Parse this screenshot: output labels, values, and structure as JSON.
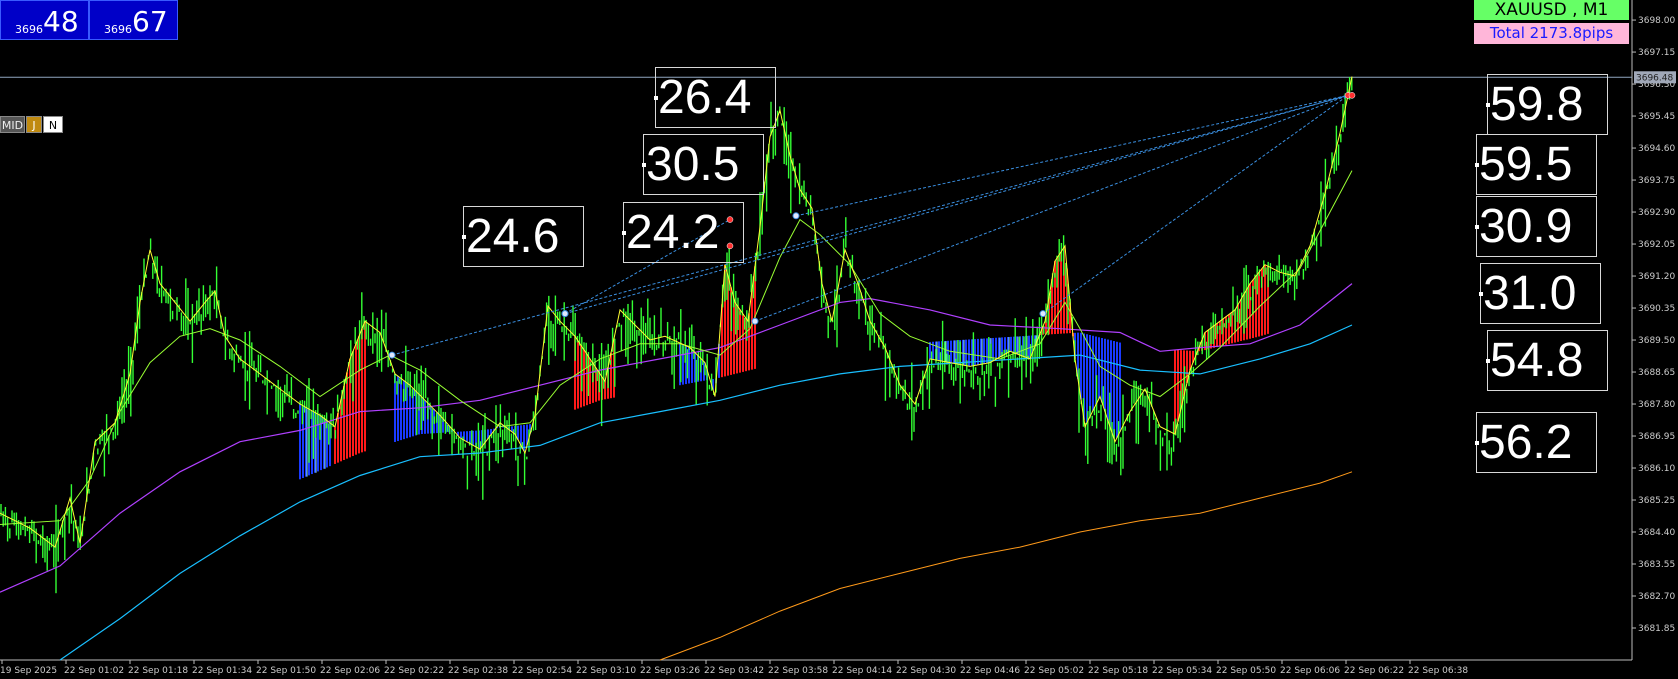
{
  "bid_boxes": [
    {
      "small": "3696",
      "big": "48"
    },
    {
      "small": "3696",
      "big": "67"
    }
  ],
  "mode_buttons": [
    "MID",
    "J",
    "N"
  ],
  "symbol_label": "XAUUSD , M1",
  "total_label": "Total  2173.8pips",
  "current_price_label": "3696.48",
  "labels": [
    "26.4",
    "30.5",
    "24.6",
    "24.2",
    "59.8",
    "59.5",
    "30.9",
    "31.0",
    "54.8",
    "56.2"
  ],
  "chart_data": {
    "type": "line",
    "title": "XAUUSD , M1",
    "ylim": [
      3681.0,
      3698.4
    ],
    "y_ticks": [
      "3698.00",
      "3697.15",
      "3696.30",
      "3695.45",
      "3694.60",
      "3693.75",
      "3692.90",
      "3692.05",
      "3691.20",
      "3690.35",
      "3689.50",
      "3688.65",
      "3687.80",
      "3686.95",
      "3686.10",
      "3685.25",
      "3684.40",
      "3683.55",
      "3682.70",
      "3681.85"
    ],
    "x_ticks": [
      "19 Sep 2025",
      "22 Sep 01:02",
      "22 Sep 01:18",
      "22 Sep 01:34",
      "22 Sep 01:50",
      "22 Sep 02:06",
      "22 Sep 02:22",
      "22 Sep 02:38",
      "22 Sep 02:54",
      "22 Sep 03:10",
      "22 Sep 03:26",
      "22 Sep 03:42",
      "22 Sep 03:58",
      "22 Sep 04:14",
      "22 Sep 04:30",
      "22 Sep 04:46",
      "22 Sep 05:02",
      "22 Sep 05:18",
      "22 Sep 05:34",
      "22 Sep 05:50",
      "22 Sep 06:06",
      "22 Sep 06:22",
      "22 Sep 06:38"
    ],
    "current_price": 3696.48,
    "colors": {
      "price": "#33ff33",
      "fast_ma": "#ffff33",
      "mid_ma": "#99ff33",
      "purple_ma": "#b040ff",
      "cyan_ma": "#19bfff",
      "orange_ma": "#ff9a1a",
      "bull_fill": "#ff1a1a",
      "bear_fill": "#1a3aff"
    },
    "series": [
      {
        "points": [
          [
            0,
            3684.9
          ],
          [
            30,
            3684.5
          ],
          [
            55,
            3684.0
          ],
          [
            70,
            3685.3
          ],
          [
            80,
            3684.1
          ],
          [
            95,
            3686.8
          ],
          [
            115,
            3687.3
          ],
          [
            130,
            3688.6
          ],
          [
            140,
            3690.5
          ],
          [
            150,
            3691.9
          ],
          [
            160,
            3691.0
          ],
          [
            175,
            3690.5
          ],
          [
            190,
            3690.0
          ],
          [
            205,
            3690.5
          ],
          [
            215,
            3690.8
          ],
          [
            225,
            3689.6
          ],
          [
            240,
            3689.0
          ],
          [
            260,
            3688.6
          ],
          [
            280,
            3688.2
          ],
          [
            300,
            3687.8
          ],
          [
            320,
            3687.5
          ],
          [
            335,
            3687.2
          ],
          [
            350,
            3689.0
          ],
          [
            365,
            3690.0
          ],
          [
            380,
            3689.7
          ],
          [
            395,
            3688.6
          ],
          [
            410,
            3688.3
          ],
          [
            425,
            3687.9
          ],
          [
            440,
            3687.5
          ],
          [
            460,
            3686.9
          ],
          [
            480,
            3686.6
          ],
          [
            500,
            3687.3
          ],
          [
            515,
            3687.0
          ],
          [
            525,
            3686.5
          ],
          [
            535,
            3687.5
          ],
          [
            548,
            3690.4
          ],
          [
            560,
            3690.0
          ],
          [
            575,
            3689.6
          ],
          [
            590,
            3689.0
          ],
          [
            605,
            3688.4
          ],
          [
            620,
            3690.3
          ],
          [
            635,
            3689.9
          ],
          [
            650,
            3689.5
          ],
          [
            665,
            3689.6
          ],
          [
            690,
            3689.3
          ],
          [
            705,
            3688.9
          ],
          [
            715,
            3688.0
          ],
          [
            725,
            3691.5
          ],
          [
            735,
            3690.5
          ],
          [
            748,
            3690.0
          ],
          [
            760,
            3692.5
          ],
          [
            770,
            3694.9
          ],
          [
            780,
            3695.6
          ],
          [
            790,
            3694.4
          ],
          [
            800,
            3693.5
          ],
          [
            812,
            3693.0
          ],
          [
            822,
            3691.0
          ],
          [
            832,
            3690.0
          ],
          [
            845,
            3691.9
          ],
          [
            858,
            3691.0
          ],
          [
            870,
            3690.0
          ],
          [
            885,
            3689.3
          ],
          [
            900,
            3688.3
          ],
          [
            915,
            3687.8
          ],
          [
            930,
            3689.0
          ],
          [
            950,
            3688.9
          ],
          [
            970,
            3688.8
          ],
          [
            990,
            3688.9
          ],
          [
            1010,
            3689.2
          ],
          [
            1030,
            3689.0
          ],
          [
            1045,
            3690.0
          ],
          [
            1055,
            3691.6
          ],
          [
            1065,
            3692.0
          ],
          [
            1075,
            3689.0
          ],
          [
            1085,
            3687.2
          ],
          [
            1100,
            3688.0
          ],
          [
            1115,
            3686.8
          ],
          [
            1130,
            3687.6
          ],
          [
            1145,
            3688.2
          ],
          [
            1160,
            3687.2
          ],
          [
            1175,
            3687.0
          ],
          [
            1190,
            3688.7
          ],
          [
            1205,
            3689.7
          ],
          [
            1220,
            3690.0
          ],
          [
            1235,
            3690.3
          ],
          [
            1250,
            3691.0
          ],
          [
            1265,
            3691.5
          ],
          [
            1280,
            3691.3
          ],
          [
            1295,
            3691.2
          ],
          [
            1310,
            3692.0
          ],
          [
            1325,
            3693.4
          ],
          [
            1340,
            3695.0
          ],
          [
            1352,
            3696.5
          ]
        ]
      },
      {
        "points": [
          [
            0,
            3684.6
          ],
          [
            60,
            3684.7
          ],
          [
            90,
            3685.8
          ],
          [
            120,
            3687.6
          ],
          [
            150,
            3688.9
          ],
          [
            180,
            3689.6
          ],
          [
            210,
            3689.8
          ],
          [
            240,
            3689.5
          ],
          [
            280,
            3688.8
          ],
          [
            320,
            3688.0
          ],
          [
            360,
            3688.7
          ],
          [
            390,
            3689.1
          ],
          [
            420,
            3688.7
          ],
          [
            460,
            3687.9
          ],
          [
            500,
            3687.2
          ],
          [
            530,
            3687.3
          ],
          [
            560,
            3688.3
          ],
          [
            600,
            3689.0
          ],
          [
            640,
            3689.4
          ],
          [
            680,
            3689.4
          ],
          [
            720,
            3689.1
          ],
          [
            750,
            3689.8
          ],
          [
            780,
            3691.7
          ],
          [
            800,
            3692.7
          ],
          [
            820,
            3692.3
          ],
          [
            850,
            3691.5
          ],
          [
            880,
            3690.2
          ],
          [
            910,
            3689.6
          ],
          [
            950,
            3689.2
          ],
          [
            1000,
            3689.0
          ],
          [
            1040,
            3689.4
          ],
          [
            1065,
            3690.5
          ],
          [
            1080,
            3689.8
          ],
          [
            1100,
            3688.8
          ],
          [
            1130,
            3688.3
          ],
          [
            1160,
            3688.0
          ],
          [
            1190,
            3688.6
          ],
          [
            1220,
            3689.3
          ],
          [
            1260,
            3690.4
          ],
          [
            1300,
            3691.4
          ],
          [
            1330,
            3692.9
          ],
          [
            1352,
            3694.0
          ]
        ]
      },
      {
        "points": [
          [
            0,
            3682.8
          ],
          [
            60,
            3683.5
          ],
          [
            120,
            3684.9
          ],
          [
            180,
            3686.0
          ],
          [
            240,
            3686.8
          ],
          [
            300,
            3687.1
          ],
          [
            360,
            3687.6
          ],
          [
            420,
            3687.7
          ],
          [
            480,
            3687.9
          ],
          [
            540,
            3688.3
          ],
          [
            600,
            3688.7
          ],
          [
            660,
            3689.0
          ],
          [
            720,
            3689.3
          ],
          [
            780,
            3689.9
          ],
          [
            840,
            3690.5
          ],
          [
            870,
            3690.6
          ],
          [
            930,
            3690.3
          ],
          [
            990,
            3689.9
          ],
          [
            1060,
            3689.8
          ],
          [
            1120,
            3689.7
          ],
          [
            1160,
            3689.2
          ],
          [
            1200,
            3689.3
          ],
          [
            1250,
            3689.4
          ],
          [
            1300,
            3689.9
          ],
          [
            1352,
            3691.0
          ]
        ]
      },
      {
        "points": [
          [
            60,
            3681.0
          ],
          [
            120,
            3682.1
          ],
          [
            180,
            3683.3
          ],
          [
            240,
            3684.3
          ],
          [
            300,
            3685.2
          ],
          [
            360,
            3685.9
          ],
          [
            420,
            3686.4
          ],
          [
            480,
            3686.5
          ],
          [
            540,
            3686.7
          ],
          [
            600,
            3687.3
          ],
          [
            660,
            3687.6
          ],
          [
            720,
            3687.9
          ],
          [
            780,
            3688.3
          ],
          [
            840,
            3688.6
          ],
          [
            900,
            3688.8
          ],
          [
            960,
            3688.9
          ],
          [
            1020,
            3689.0
          ],
          [
            1080,
            3689.1
          ],
          [
            1140,
            3688.7
          ],
          [
            1200,
            3688.6
          ],
          [
            1260,
            3689.0
          ],
          [
            1310,
            3689.4
          ],
          [
            1352,
            3689.9
          ]
        ]
      },
      {
        "points": [
          [
            660,
            3681.0
          ],
          [
            720,
            3681.6
          ],
          [
            780,
            3682.3
          ],
          [
            840,
            3682.9
          ],
          [
            900,
            3683.3
          ],
          [
            960,
            3683.7
          ],
          [
            1020,
            3684.0
          ],
          [
            1080,
            3684.4
          ],
          [
            1140,
            3684.7
          ],
          [
            1200,
            3684.9
          ],
          [
            1260,
            3685.3
          ],
          [
            1320,
            3685.7
          ],
          [
            1352,
            3686.0
          ]
        ]
      }
    ],
    "dashed_lines": [
      {
        "from": [
          392,
          3689.1
        ],
        "to": [
          1348,
          3696.0
        ]
      },
      {
        "from": [
          565,
          3690.2
        ],
        "to": [
          1348,
          3696.0
        ]
      },
      {
        "from": [
          755,
          3690.0
        ],
        "to": [
          1348,
          3696.0
        ]
      },
      {
        "from": [
          796,
          3692.8
        ],
        "to": [
          1348,
          3696.0
        ]
      },
      {
        "from": [
          1043,
          3690.2
        ],
        "to": [
          1348,
          3696.0
        ]
      },
      {
        "from": [
          565,
          3690.2
        ],
        "to": [
          730,
          3692.7
        ]
      }
    ],
    "fill_zones": [
      {
        "from": 300,
        "to": 330,
        "kind": "bear"
      },
      {
        "from": 335,
        "to": 365,
        "kind": "bull"
      },
      {
        "from": 395,
        "to": 535,
        "kind": "bear"
      },
      {
        "from": 575,
        "to": 615,
        "kind": "bull"
      },
      {
        "from": 680,
        "to": 720,
        "kind": "bear"
      },
      {
        "from": 722,
        "to": 755,
        "kind": "bull"
      },
      {
        "from": 930,
        "to": 1040,
        "kind": "bear"
      },
      {
        "from": 1040,
        "to": 1075,
        "kind": "bull"
      },
      {
        "from": 1075,
        "to": 1120,
        "kind": "bear"
      },
      {
        "from": 1175,
        "to": 1270,
        "kind": "bull"
      }
    ]
  }
}
